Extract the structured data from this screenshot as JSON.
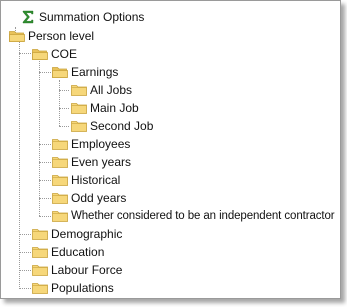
{
  "tree": {
    "summation": {
      "label": "Summation Options",
      "icon": "sigma-icon",
      "color": "#2f8f2f"
    },
    "person_level": {
      "label": "Person level",
      "icon": "folder-open-icon"
    },
    "coe": {
      "label": "COE",
      "icon": "folder-open-icon"
    },
    "earnings": {
      "label": "Earnings",
      "icon": "folder-open-icon"
    },
    "all_jobs": {
      "label": "All Jobs",
      "icon": "folder-icon"
    },
    "main_job": {
      "label": "Main Job",
      "icon": "folder-icon"
    },
    "second_job": {
      "label": "Second Job",
      "icon": "folder-icon"
    },
    "employees": {
      "label": "Employees",
      "icon": "folder-icon"
    },
    "even_years": {
      "label": "Even years",
      "icon": "folder-icon"
    },
    "historical": {
      "label": "Historical",
      "icon": "folder-icon"
    },
    "odd_years": {
      "label": "Odd years",
      "icon": "folder-icon"
    },
    "independent_contractor": {
      "label": "Whether considered to be an independent contractor",
      "icon": "folder-icon"
    },
    "demographic": {
      "label": "Demographic",
      "icon": "folder-icon"
    },
    "education": {
      "label": "Education",
      "icon": "folder-icon"
    },
    "labour_force": {
      "label": "Labour Force",
      "icon": "folder-icon"
    },
    "populations": {
      "label": "Populations",
      "icon": "folder-icon"
    }
  },
  "colors": {
    "folder_fill": "#f6d77a",
    "folder_stroke": "#c9a23a",
    "folder_tab": "#e9c25a",
    "connector": "#9a9a9a"
  }
}
